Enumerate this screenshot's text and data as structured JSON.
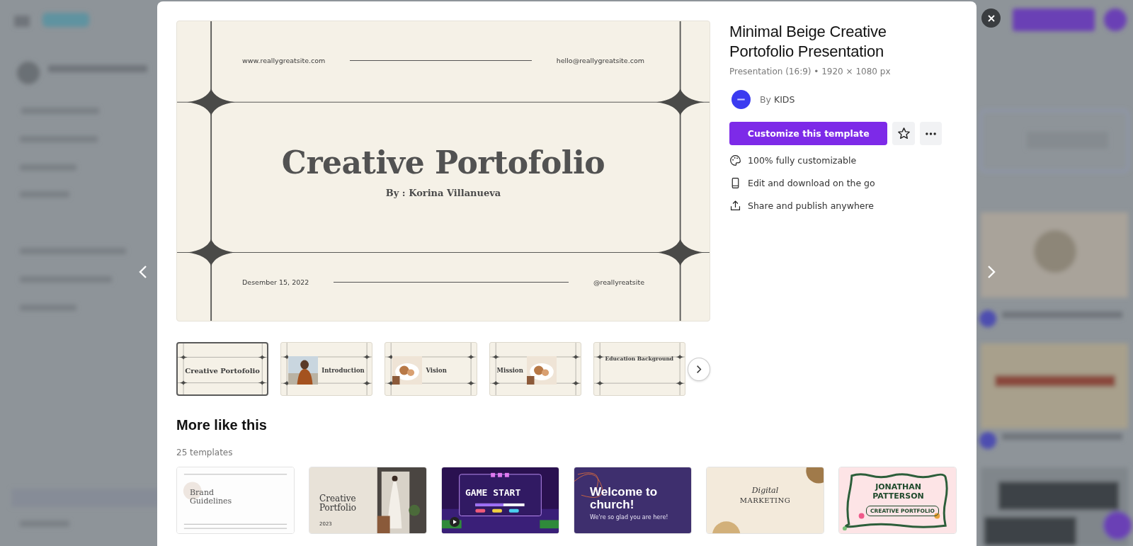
{
  "modal": {
    "preview": {
      "website": "www.reallygreatsite.com",
      "email": "hello@reallygreatsite.com",
      "title": "Creative Portofolio",
      "author": "By : Korina Villanueva",
      "date": "Desember 15, 2022",
      "handle": "@reallyreatsite"
    },
    "pages": [
      {
        "title": "Creative Portofolio",
        "kind": "cover",
        "selected": true
      },
      {
        "title": "Introduction",
        "kind": "photoleft",
        "selected": false
      },
      {
        "title": "Vision",
        "kind": "photoleft",
        "selected": false
      },
      {
        "title": "Mission",
        "kind": "photoright",
        "selected": false
      },
      {
        "title": "Education Background",
        "kind": "center",
        "selected": false
      }
    ],
    "details": {
      "title": "Minimal Beige Creative Portofolio Presentation",
      "meta": "Presentation (16:9) • 1920 × 1080 px",
      "by_label": "By",
      "author": "KIDS",
      "primary_button": "Customize this template",
      "features": [
        {
          "kind": "palette",
          "text": "100% fully customizable"
        },
        {
          "kind": "phone",
          "text": "Edit and download on the go"
        },
        {
          "kind": "share",
          "text": "Share and publish anywhere"
        }
      ]
    },
    "more": {
      "heading": "More like this",
      "count": "25 templates",
      "templates": [
        {
          "kind": "brand",
          "texts": [
            "Brand Guidelines"
          ]
        },
        {
          "kind": "portfolio",
          "texts": [
            "Creative Portfolio",
            "2023"
          ]
        },
        {
          "kind": "game",
          "texts": [
            "GAME START"
          ]
        },
        {
          "kind": "church",
          "texts": [
            "Welcome to church!",
            "We're so glad you are here!"
          ]
        },
        {
          "kind": "marketing",
          "texts": [
            "Digital",
            "MARKETING"
          ]
        },
        {
          "kind": "jonathan",
          "texts": [
            "JONATHAN PATTERSON",
            "CREATIVE PORTFOLIO"
          ]
        }
      ]
    }
  }
}
